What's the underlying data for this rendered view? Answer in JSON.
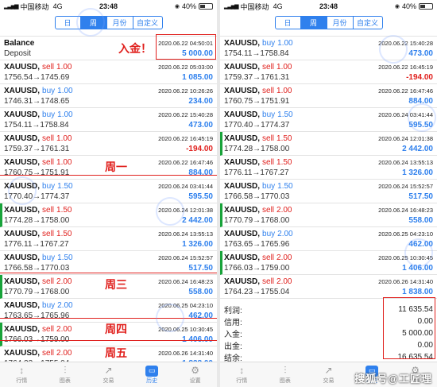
{
  "status_bar": {
    "carrier": "中国移动",
    "network": "4G",
    "time": "23:48",
    "battery": "40%"
  },
  "tabs": [
    "日",
    "周",
    "月份",
    "自定义"
  ],
  "active_tab": "周",
  "left_rows": [
    {
      "sym": "Balance",
      "side": "",
      "lots": "",
      "ts": "2020.06.22 04:50:01",
      "p1": "Deposit",
      "p2": "",
      "profit": "5 000.00",
      "kind": "pos",
      "mark": false,
      "bal": true
    },
    {
      "sym": "XAUUSD,",
      "side": "sell",
      "lots": "1.00",
      "ts": "2020.06.22 05:03:00",
      "p1": "1756.54",
      "p2": "1745.69",
      "profit": "1 085.00",
      "kind": "pos",
      "mark": false
    },
    {
      "sym": "XAUUSD,",
      "side": "buy",
      "lots": "1.00",
      "ts": "2020.06.22 10:26:26",
      "p1": "1746.31",
      "p2": "1748.65",
      "profit": "234.00",
      "kind": "pos",
      "mark": false
    },
    {
      "sym": "XAUUSD,",
      "side": "buy",
      "lots": "1.00",
      "ts": "2020.06.22 15:40:28",
      "p1": "1754.11",
      "p2": "1758.84",
      "profit": "473.00",
      "kind": "pos",
      "mark": false
    },
    {
      "sym": "XAUUSD,",
      "side": "sell",
      "lots": "1.00",
      "ts": "2020.06.22 16:45:19",
      "p1": "1759.37",
      "p2": "1761.31",
      "profit": "-194.00",
      "kind": "neg",
      "mark": false
    },
    {
      "sym": "XAUUSD,",
      "side": "sell",
      "lots": "1.00",
      "ts": "2020.06.22 16:47:46",
      "p1": "1760.75",
      "p2": "1751.91",
      "profit": "884.00",
      "kind": "pos",
      "mark": false
    },
    {
      "sym": "XAUUSD,",
      "side": "buy",
      "lots": "1.50",
      "ts": "2020.06.24 03:41:44",
      "p1": "1770.40",
      "p2": "1774.37",
      "profit": "595.50",
      "kind": "pos",
      "mark": false
    },
    {
      "sym": "XAUUSD,",
      "side": "sell",
      "lots": "1.50",
      "ts": "2020.06.24 12:01:38",
      "p1": "1774.28",
      "p2": "1758.00",
      "profit": "2 442.00",
      "kind": "pos",
      "mark": true
    },
    {
      "sym": "XAUUSD,",
      "side": "sell",
      "lots": "1.50",
      "ts": "2020.06.24 13:55:13",
      "p1": "1776.11",
      "p2": "1767.27",
      "profit": "1 326.00",
      "kind": "pos",
      "mark": false
    },
    {
      "sym": "XAUUSD,",
      "side": "buy",
      "lots": "1.50",
      "ts": "2020.06.24 15:52:57",
      "p1": "1766.58",
      "p2": "1770.03",
      "profit": "517.50",
      "kind": "pos",
      "mark": false
    },
    {
      "sym": "XAUUSD,",
      "side": "sell",
      "lots": "2.00",
      "ts": "2020.06.24 16:48:23",
      "p1": "1770.79",
      "p2": "1768.00",
      "profit": "558.00",
      "kind": "pos",
      "mark": true
    },
    {
      "sym": "XAUUSD,",
      "side": "buy",
      "lots": "2.00",
      "ts": "2020.06.25 04:23:10",
      "p1": "1763.65",
      "p2": "1765.96",
      "profit": "462.00",
      "kind": "pos",
      "mark": false
    },
    {
      "sym": "XAUUSD,",
      "side": "sell",
      "lots": "2.00",
      "ts": "2020.06.25 10:30:45",
      "p1": "1766.03",
      "p2": "1759.00",
      "profit": "1 406.00",
      "kind": "pos",
      "mark": true
    },
    {
      "sym": "XAUUSD,",
      "side": "sell",
      "lots": "2.00",
      "ts": "2020.06.26 14:31:40",
      "p1": "1764.23",
      "p2": "1755.04",
      "profit": "1 838.00",
      "kind": "pos",
      "mark": false
    }
  ],
  "right_rows": [
    {
      "sym": "XAUUSD,",
      "side": "buy",
      "lots": "1.00",
      "ts": "2020.06.22 15:40:28",
      "p1": "1754.11",
      "p2": "1758.84",
      "profit": "473.00",
      "kind": "pos",
      "mark": false
    },
    {
      "sym": "XAUUSD,",
      "side": "sell",
      "lots": "1.00",
      "ts": "2020.06.22 16:45:19",
      "p1": "1759.37",
      "p2": "1761.31",
      "profit": "-194.00",
      "kind": "neg",
      "mark": false
    },
    {
      "sym": "XAUUSD,",
      "side": "sell",
      "lots": "1.00",
      "ts": "2020.06.22 16:47:46",
      "p1": "1760.75",
      "p2": "1751.91",
      "profit": "884.00",
      "kind": "pos",
      "mark": false
    },
    {
      "sym": "XAUUSD,",
      "side": "buy",
      "lots": "1.50",
      "ts": "2020.06.24 03:41:44",
      "p1": "1770.40",
      "p2": "1774.37",
      "profit": "595.50",
      "kind": "pos",
      "mark": false
    },
    {
      "sym": "XAUUSD,",
      "side": "sell",
      "lots": "1.50",
      "ts": "2020.06.24 12:01:38",
      "p1": "1774.28",
      "p2": "1758.00",
      "profit": "2 442.00",
      "kind": "pos",
      "mark": true
    },
    {
      "sym": "XAUUSD,",
      "side": "sell",
      "lots": "1.50",
      "ts": "2020.06.24 13:55:13",
      "p1": "1776.11",
      "p2": "1767.27",
      "profit": "1 326.00",
      "kind": "pos",
      "mark": false
    },
    {
      "sym": "XAUUSD,",
      "side": "buy",
      "lots": "1.50",
      "ts": "2020.06.24 15:52:57",
      "p1": "1766.58",
      "p2": "1770.03",
      "profit": "517.50",
      "kind": "pos",
      "mark": false
    },
    {
      "sym": "XAUUSD,",
      "side": "sell",
      "lots": "2.00",
      "ts": "2020.06.24 16:48:23",
      "p1": "1770.79",
      "p2": "1768.00",
      "profit": "558.00",
      "kind": "pos",
      "mark": true
    },
    {
      "sym": "XAUUSD,",
      "side": "buy",
      "lots": "2.00",
      "ts": "2020.06.25 04:23:10",
      "p1": "1763.65",
      "p2": "1765.96",
      "profit": "462.00",
      "kind": "pos",
      "mark": false
    },
    {
      "sym": "XAUUSD,",
      "side": "sell",
      "lots": "2.00",
      "ts": "2020.06.25 10:30:45",
      "p1": "1766.03",
      "p2": "1759.00",
      "profit": "1 406.00",
      "kind": "pos",
      "mark": true
    },
    {
      "sym": "XAUUSD,",
      "side": "sell",
      "lots": "2.00",
      "ts": "2020.06.26 14:31:40",
      "p1": "1764.23",
      "p2": "1755.04",
      "profit": "1 838.00",
      "kind": "pos",
      "mark": false
    }
  ],
  "summary": [
    {
      "label": "利润:",
      "value": "11 635.54"
    },
    {
      "label": "信用:",
      "value": "0.00"
    },
    {
      "label": "入金:",
      "value": "5 000.00"
    },
    {
      "label": "出金:",
      "value": "0.00"
    },
    {
      "label": "结余:",
      "value": "16 635.54"
    }
  ],
  "nav": [
    {
      "label": "行情",
      "icon": "↕",
      "name": "quotes-icon"
    },
    {
      "label": "图表",
      "icon": "⫶",
      "name": "chart-icon"
    },
    {
      "label": "交易",
      "icon": "↗",
      "name": "trade-icon"
    },
    {
      "label": "历史",
      "icon": "▭",
      "name": "history-icon"
    },
    {
      "label": "设置",
      "icon": "⚙",
      "name": "settings-icon"
    }
  ],
  "active_nav": "历史",
  "annotations": {
    "deposit_note": "入金！",
    "monday": "周一",
    "wednesday": "周三",
    "thursday": "周四",
    "friday": "周五"
  },
  "watermark": "搜狐号@工匠理"
}
